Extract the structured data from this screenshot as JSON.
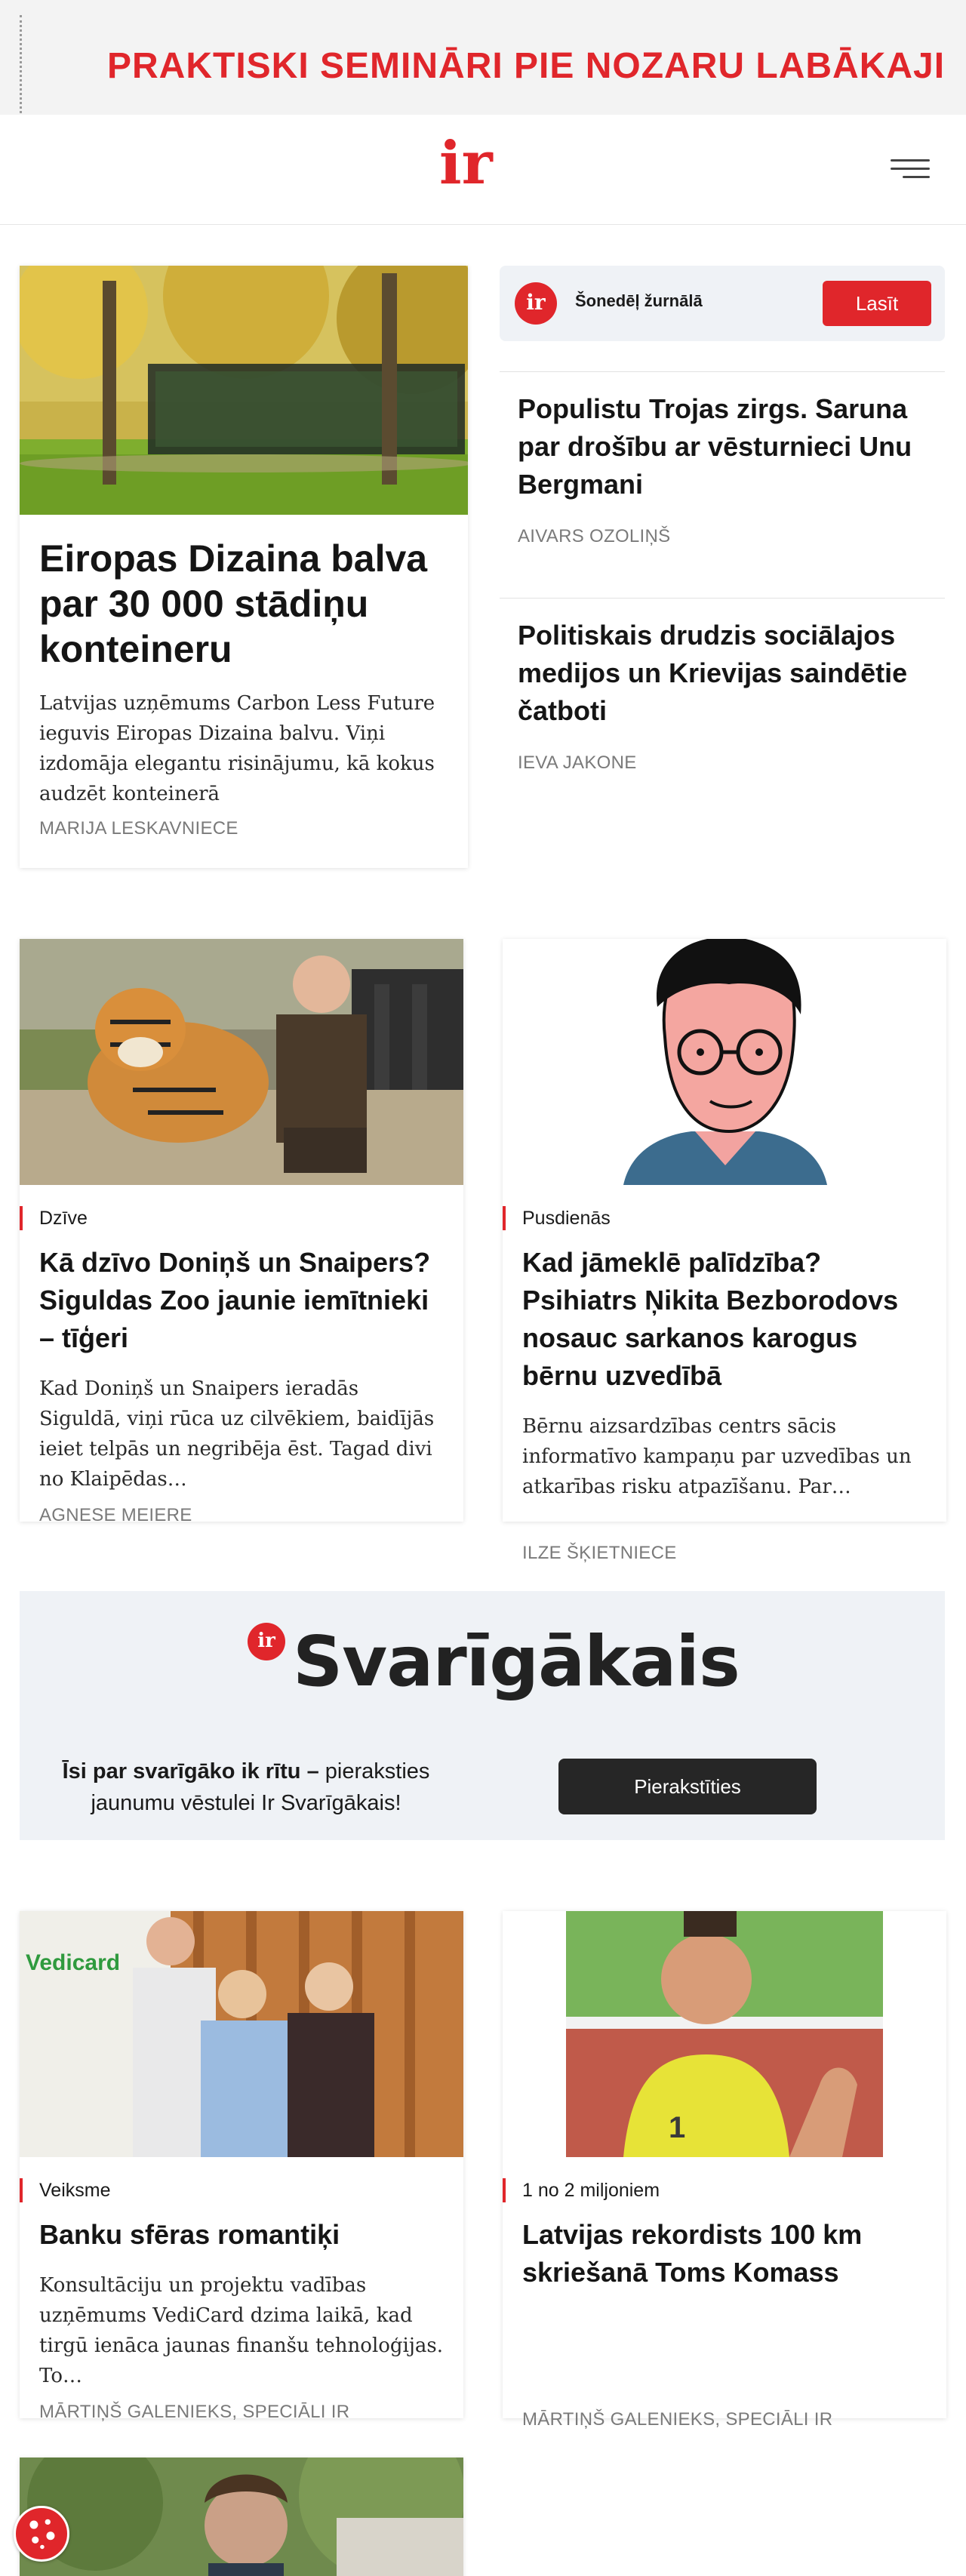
{
  "banner": {
    "text": "PRAKTISKI SEMINĀRI PIE NOZARU LABĀKAJI"
  },
  "header": {
    "logo": "ir",
    "menu_icon": "hamburger-menu-icon"
  },
  "featured": {
    "title": "Eiropas Dizaina balva par 30 000 stādiņu konteineru",
    "lead": "Latvijas uzņēmums Carbon Less Future ieguvis Eiropas Dizaina balvu. Viņi izdomāja elegantu risinājumu, kā kokus audzēt konteinerā",
    "author": "MARIJA LESKAVNIECE"
  },
  "magazine": {
    "logo": "ir",
    "label": "Šonedēļ žurnālā",
    "button": "Lasīt"
  },
  "side_articles": [
    {
      "title": "Populistu Trojas zirgs. Saruna par drošību ar vēsturnieci Unu Bergmani",
      "author": "AIVARS OZOLIŅŠ"
    },
    {
      "title": "Politiskais drudzis sociālajos medijos un Krievijas saindētie čatboti",
      "author": "IEVA JAKONE"
    }
  ],
  "cards_row1": [
    {
      "category": "Dzīve",
      "title": "Kā dzīvo Doniņš un Snaipers? Siguldas Zoo jaunie iemītnieki – tīģeri",
      "lead": "Kad Doniņš un Snaipers ieradās Siguldā, viņi rūca uz cilvēkiem, baidījās ieiet telpās un negribēja ēst. Tagad divi no Klaipēdas…",
      "author": "AGNESE MEIERE"
    },
    {
      "category": "Pusdienās",
      "title": "Kad jāmeklē palīdzība? Psihiatrs Ņikita Bezborodovs nosauc sarkanos karogus bērnu uzvedībā",
      "lead": "Bērnu aizsardzības centrs sācis informatīvo kampaņu par uzvedības un atkarības risku atpazīšanu. Par…",
      "author": "ILZE ŠĶIETNIECE"
    }
  ],
  "newsletter": {
    "logo": "ir",
    "title": "Svarīgākais",
    "text_bold": "Īsi par svarīgāko ik rītu –",
    "text_rest": " pieraksties jaunumu vēstulei Ir Svarīgākais!",
    "button": "Pierakstīties"
  },
  "cards_row2": [
    {
      "category": "Veiksme",
      "title": "Banku sfēras romantiķi",
      "lead": "Konsultāciju un projektu vadības uzņēmums VediCard dzima laikā, kad tirgū ienāca jaunas finanšu tehnoloģijas. To…",
      "author": "MĀRTIŅŠ GALENIEKS, SPECIĀLI IR",
      "image_text": "Vedicard"
    },
    {
      "category": "1 no 2 miljoniem",
      "title": "Latvijas rekordists 100 km skriešanā Toms Komass",
      "lead": "",
      "author": "MĀRTIŅŠ GALENIEKS, SPECIĀLI IR"
    }
  ],
  "colors": {
    "accent": "#e0262b",
    "dark_button": "#262626",
    "box_bg": "#eff2f6"
  },
  "cookie_icon": "cookie-icon"
}
